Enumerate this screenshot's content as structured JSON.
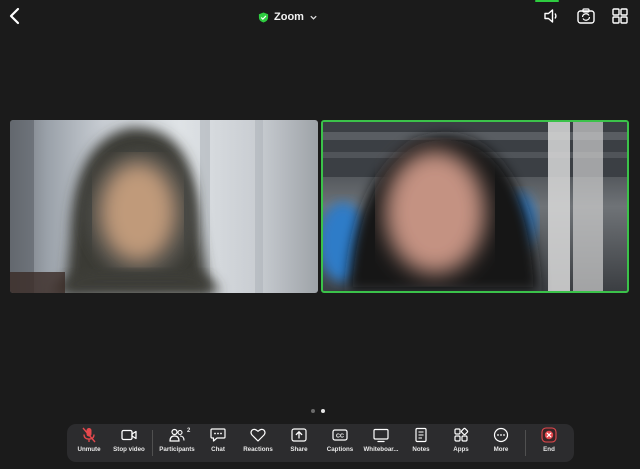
{
  "header": {
    "title": "Zoom",
    "icons": [
      "back-chevron-icon",
      "shield-check-icon",
      "chevron-down-icon",
      "speaker-icon",
      "camera-switch-icon",
      "grid-view-icon"
    ]
  },
  "video_tiles": [
    {
      "name": "participant-tile-1",
      "speaking": false
    },
    {
      "name": "participant-tile-2",
      "speaking": true
    }
  ],
  "pagination": {
    "pages": 2,
    "current": 2
  },
  "toolbar": {
    "items": [
      {
        "label": "Unmute",
        "icon": "mic-muted-icon"
      },
      {
        "label": "Stop video",
        "icon": "video-camera-icon"
      },
      {
        "label": "Participants",
        "icon": "participants-icon",
        "count": "2"
      },
      {
        "label": "Chat",
        "icon": "chat-bubble-icon"
      },
      {
        "label": "Reactions",
        "icon": "heart-icon"
      },
      {
        "label": "Share",
        "icon": "share-upload-icon"
      },
      {
        "label": "Captions",
        "icon": "cc-icon"
      },
      {
        "label": "Whiteboar...",
        "icon": "whiteboard-icon"
      },
      {
        "label": "Notes",
        "icon": "notes-icon"
      },
      {
        "label": "Apps",
        "icon": "apps-icon"
      },
      {
        "label": "More",
        "icon": "more-dots-icon"
      },
      {
        "label": "End",
        "icon": "end-x-icon"
      }
    ]
  },
  "colors": {
    "background": "#1b1b1b",
    "toolbar": "#2c2c2e",
    "active_speaker": "#3bc24a",
    "end": "#e5484d",
    "muted": "#e5484d"
  }
}
